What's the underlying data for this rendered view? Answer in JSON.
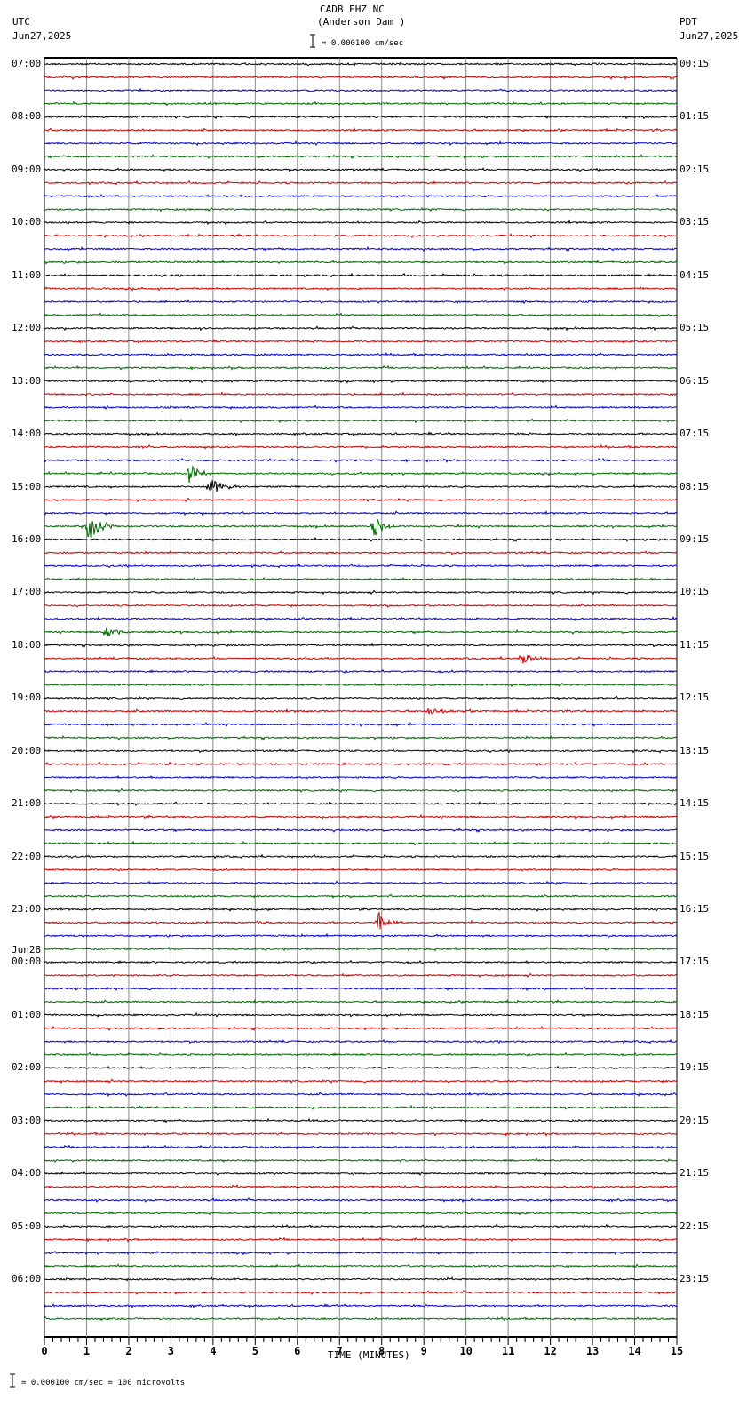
{
  "header": {
    "station": "CADB EHZ NC",
    "location": "(Anderson Dam )",
    "left_tz": "UTC",
    "left_date": "Jun27,2025",
    "right_tz": "PDT",
    "right_date": "Jun27,2025",
    "scale_text": "= 0.000100 cm/sec"
  },
  "footer": {
    "scale_text": "= 0.000100 cm/sec =     100 microvolts"
  },
  "chart_data": {
    "type": "line",
    "title": "CADB EHZ NC (Anderson Dam )",
    "xlabel": "TIME (MINUTES)",
    "xlim": [
      0,
      15
    ],
    "x_ticks": [
      "0",
      "1",
      "2",
      "3",
      "4",
      "5",
      "6",
      "7",
      "8",
      "9",
      "10",
      "11",
      "12",
      "13",
      "14",
      "15"
    ],
    "grid": true,
    "trace_count": 96,
    "trace_minutes": 15,
    "trace_colors": [
      "#000000",
      "#cc0000",
      "#0000cc",
      "#006600"
    ],
    "left_labels": [
      {
        "row": 0,
        "text": "07:00"
      },
      {
        "row": 4,
        "text": "08:00"
      },
      {
        "row": 8,
        "text": "09:00"
      },
      {
        "row": 12,
        "text": "10:00"
      },
      {
        "row": 16,
        "text": "11:00"
      },
      {
        "row": 20,
        "text": "12:00"
      },
      {
        "row": 24,
        "text": "13:00"
      },
      {
        "row": 28,
        "text": "14:00"
      },
      {
        "row": 32,
        "text": "15:00"
      },
      {
        "row": 36,
        "text": "16:00"
      },
      {
        "row": 40,
        "text": "17:00"
      },
      {
        "row": 44,
        "text": "18:00"
      },
      {
        "row": 48,
        "text": "19:00"
      },
      {
        "row": 52,
        "text": "20:00"
      },
      {
        "row": 56,
        "text": "21:00"
      },
      {
        "row": 60,
        "text": "22:00"
      },
      {
        "row": 64,
        "text": "23:00"
      },
      {
        "row": 68,
        "text": "00:00",
        "date": "Jun28"
      },
      {
        "row": 72,
        "text": "01:00"
      },
      {
        "row": 76,
        "text": "02:00"
      },
      {
        "row": 80,
        "text": "03:00"
      },
      {
        "row": 84,
        "text": "04:00"
      },
      {
        "row": 88,
        "text": "05:00"
      },
      {
        "row": 92,
        "text": "06:00"
      }
    ],
    "right_labels": [
      {
        "row": 0,
        "text": "00:15"
      },
      {
        "row": 4,
        "text": "01:15"
      },
      {
        "row": 8,
        "text": "02:15"
      },
      {
        "row": 12,
        "text": "03:15"
      },
      {
        "row": 16,
        "text": "04:15"
      },
      {
        "row": 20,
        "text": "05:15"
      },
      {
        "row": 24,
        "text": "06:15"
      },
      {
        "row": 28,
        "text": "07:15"
      },
      {
        "row": 32,
        "text": "08:15"
      },
      {
        "row": 36,
        "text": "09:15"
      },
      {
        "row": 40,
        "text": "10:15"
      },
      {
        "row": 44,
        "text": "11:15"
      },
      {
        "row": 48,
        "text": "12:15"
      },
      {
        "row": 52,
        "text": "13:15"
      },
      {
        "row": 56,
        "text": "14:15"
      },
      {
        "row": 60,
        "text": "15:15"
      },
      {
        "row": 64,
        "text": "16:15"
      },
      {
        "row": 68,
        "text": "17:15"
      },
      {
        "row": 72,
        "text": "18:15"
      },
      {
        "row": 76,
        "text": "19:15"
      },
      {
        "row": 80,
        "text": "20:15"
      },
      {
        "row": 84,
        "text": "21:15"
      },
      {
        "row": 88,
        "text": "22:15"
      },
      {
        "row": 92,
        "text": "23:15"
      }
    ],
    "events": [
      {
        "row": 16,
        "minute": 14.6,
        "amplitude": 0.3,
        "duration": 0.1
      },
      {
        "row": 31,
        "minute": 3.4,
        "amplitude": 1.0,
        "duration": 0.6
      },
      {
        "row": 32,
        "minute": 3.9,
        "amplitude": 0.8,
        "duration": 0.8
      },
      {
        "row": 35,
        "minute": 1.0,
        "amplitude": 1.4,
        "duration": 0.7
      },
      {
        "row": 35,
        "minute": 7.8,
        "amplitude": 0.9,
        "duration": 0.6
      },
      {
        "row": 43,
        "minute": 1.4,
        "amplitude": 0.8,
        "duration": 0.6
      },
      {
        "row": 45,
        "minute": 11.3,
        "amplitude": 0.7,
        "duration": 0.6
      },
      {
        "row": 49,
        "minute": 9.1,
        "amplitude": 0.3,
        "duration": 1.0
      },
      {
        "row": 65,
        "minute": 5.1,
        "amplitude": 0.4,
        "duration": 0.3
      },
      {
        "row": 65,
        "minute": 7.9,
        "amplitude": 1.0,
        "duration": 0.6
      },
      {
        "row": 80,
        "minute": 6.2,
        "amplitude": 0.2,
        "duration": 0.3
      }
    ]
  }
}
